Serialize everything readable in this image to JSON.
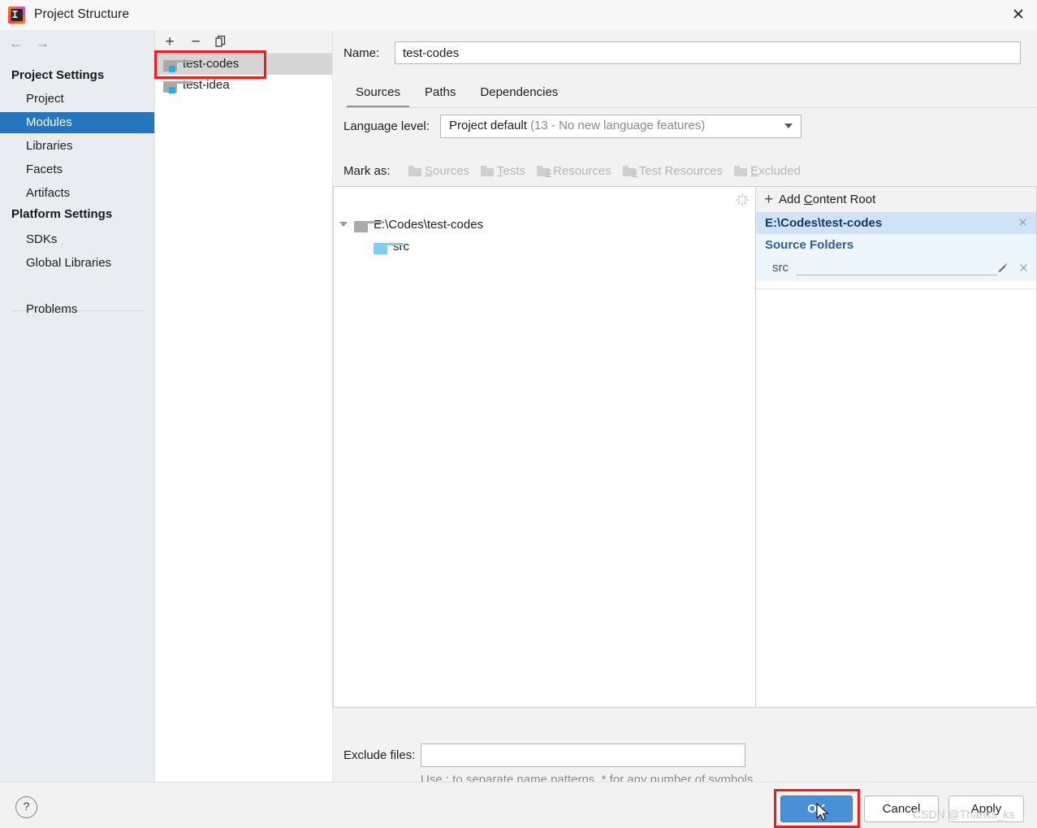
{
  "window": {
    "title": "Project Structure",
    "app_icon": "intellij-idea-icon",
    "close_label": "✕"
  },
  "sidebar": {
    "back_icon": "←",
    "forward_icon": "→",
    "groups": [
      {
        "label": "Project Settings"
      },
      {
        "label": "Platform Settings"
      }
    ],
    "items": [
      {
        "label": "Project",
        "selected": false
      },
      {
        "label": "Modules",
        "selected": true
      },
      {
        "label": "Libraries",
        "selected": false
      },
      {
        "label": "Facets",
        "selected": false
      },
      {
        "label": "Artifacts",
        "selected": false
      },
      {
        "label": "SDKs",
        "selected": false
      },
      {
        "label": "Global Libraries",
        "selected": false
      },
      {
        "label": "Problems",
        "selected": false
      }
    ]
  },
  "modules_panel": {
    "toolbar": {
      "add_label": "+",
      "remove_label": "−",
      "copy_icon": "copy-icon"
    },
    "items": [
      {
        "label": "test-codes",
        "selected": true
      },
      {
        "label": "test-idea",
        "selected": false
      }
    ]
  },
  "main": {
    "name_label": "Name:",
    "name_value": "test-codes",
    "tabs": [
      {
        "label": "Sources",
        "active": true
      },
      {
        "label": "Paths",
        "active": false
      },
      {
        "label": "Dependencies",
        "active": false
      }
    ],
    "language_level": {
      "label": "Language level:",
      "value": "Project default",
      "detail": "(13 - No new language features)"
    },
    "mark_as": {
      "label": "Mark as:",
      "options": [
        {
          "label": "Sources",
          "mnemonic": "S",
          "icon": "folder-icon"
        },
        {
          "label": "Tests",
          "mnemonic": "T",
          "icon": "folder-icon"
        },
        {
          "label": "Resources",
          "mnemonic": "",
          "icon": "resources-folder-icon"
        },
        {
          "label": "Test Resources",
          "mnemonic": "",
          "icon": "test-resources-folder-icon"
        },
        {
          "label": "Excluded",
          "mnemonic": "E",
          "icon": "folder-icon"
        }
      ]
    },
    "tree": [
      {
        "label": "E:\\Codes\\test-codes",
        "icon": "folder-gray-icon",
        "depth": 0,
        "expanded": true
      },
      {
        "label": "src",
        "icon": "folder-blue-icon",
        "depth": 1,
        "expanded": false
      }
    ],
    "content_roots": {
      "add_label": "Add Content Root",
      "add_mnemonic": "C",
      "root_path": "E:\\Codes\\test-codes",
      "root_close": "✕",
      "source_folders_label": "Source Folders",
      "source_folders": [
        {
          "label": "src",
          "edit_icon": "pencil-icon",
          "remove_icon": "✕"
        }
      ]
    },
    "exclude": {
      "label": "Exclude files:",
      "value": "",
      "hint": "Use ; to separate name patterns, * for any number of symbols, ? for one."
    }
  },
  "footer": {
    "help_label": "?",
    "ok_label": "OK",
    "cancel_label": "Cancel",
    "apply_label": "Apply"
  },
  "watermark": {
    "text": "CSDN @Thanks_ks"
  },
  "colors": {
    "accent_blue": "#2675bf",
    "ok_button": "#4a90d9",
    "annotation_red": "#ee1c1c",
    "root_header_bg": "#cfe3f7",
    "source_panel_bg": "#eef6fd"
  }
}
